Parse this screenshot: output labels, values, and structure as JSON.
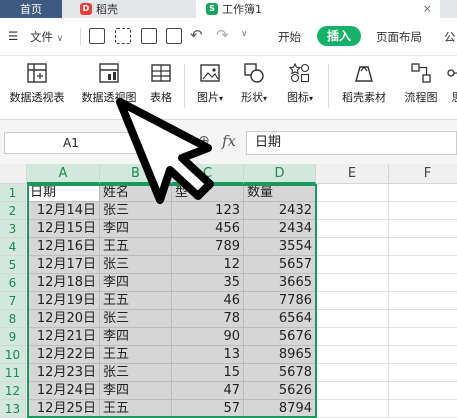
{
  "titlebar": {
    "tabs": [
      {
        "label": "首页"
      },
      {
        "label": "稻壳"
      },
      {
        "label": "工作簿1"
      }
    ],
    "docer_icon": "D",
    "sheet_icon": "S"
  },
  "menubar": {
    "file_label": "文件",
    "items": [
      "开始",
      "插入",
      "页面布局",
      "公"
    ]
  },
  "ribbon": {
    "buttons": [
      {
        "label": "数据透视表",
        "icon": "pivot-table-icon"
      },
      {
        "label": "数据透视图",
        "icon": "pivot-chart-icon"
      },
      {
        "label": "表格",
        "icon": "table-icon"
      },
      {
        "label": "图片",
        "icon": "picture-icon"
      },
      {
        "label": "形状",
        "icon": "shape-icon"
      },
      {
        "label": "图标",
        "icon": "icons-icon"
      },
      {
        "label": "稻壳素材",
        "icon": "docer-material-icon"
      },
      {
        "label": "流程图",
        "icon": "flowchart-icon"
      },
      {
        "label": "思",
        "icon": "mindmap-icon"
      }
    ]
  },
  "formula_bar": {
    "cell_ref": "A1",
    "fx": "fx",
    "content": "日期"
  },
  "columns": [
    "A",
    "B",
    "C",
    "D",
    "E",
    "F"
  ],
  "rows": [
    "1",
    "2",
    "3",
    "4",
    "5",
    "6",
    "7",
    "8",
    "9",
    "10",
    "11",
    "12",
    "13"
  ],
  "table": {
    "headers": [
      "日期",
      "姓名",
      "型号",
      "数量"
    ],
    "data": [
      [
        "12月14日",
        "张三",
        "123",
        "2432"
      ],
      [
        "12月15日",
        "李四",
        "456",
        "2434"
      ],
      [
        "12月16日",
        "王五",
        "789",
        "3554"
      ],
      [
        "12月17日",
        "张三",
        "12",
        "5657"
      ],
      [
        "12月18日",
        "李四",
        "35",
        "3665"
      ],
      [
        "12月19日",
        "王五",
        "46",
        "7786"
      ],
      [
        "12月20日",
        "张三",
        "78",
        "6564"
      ],
      [
        "12月21日",
        "李四",
        "90",
        "5676"
      ],
      [
        "12月22日",
        "王五",
        "13",
        "8965"
      ],
      [
        "12月23日",
        "张三",
        "15",
        "5678"
      ],
      [
        "12月24日",
        "李四",
        "47",
        "5626"
      ],
      [
        "12月25日",
        "王五",
        "57",
        "8794"
      ]
    ]
  },
  "colors": {
    "accent": "#1a9a5a",
    "insert_pill": "#17b26a",
    "selection_fill": "#d6d6d6"
  }
}
